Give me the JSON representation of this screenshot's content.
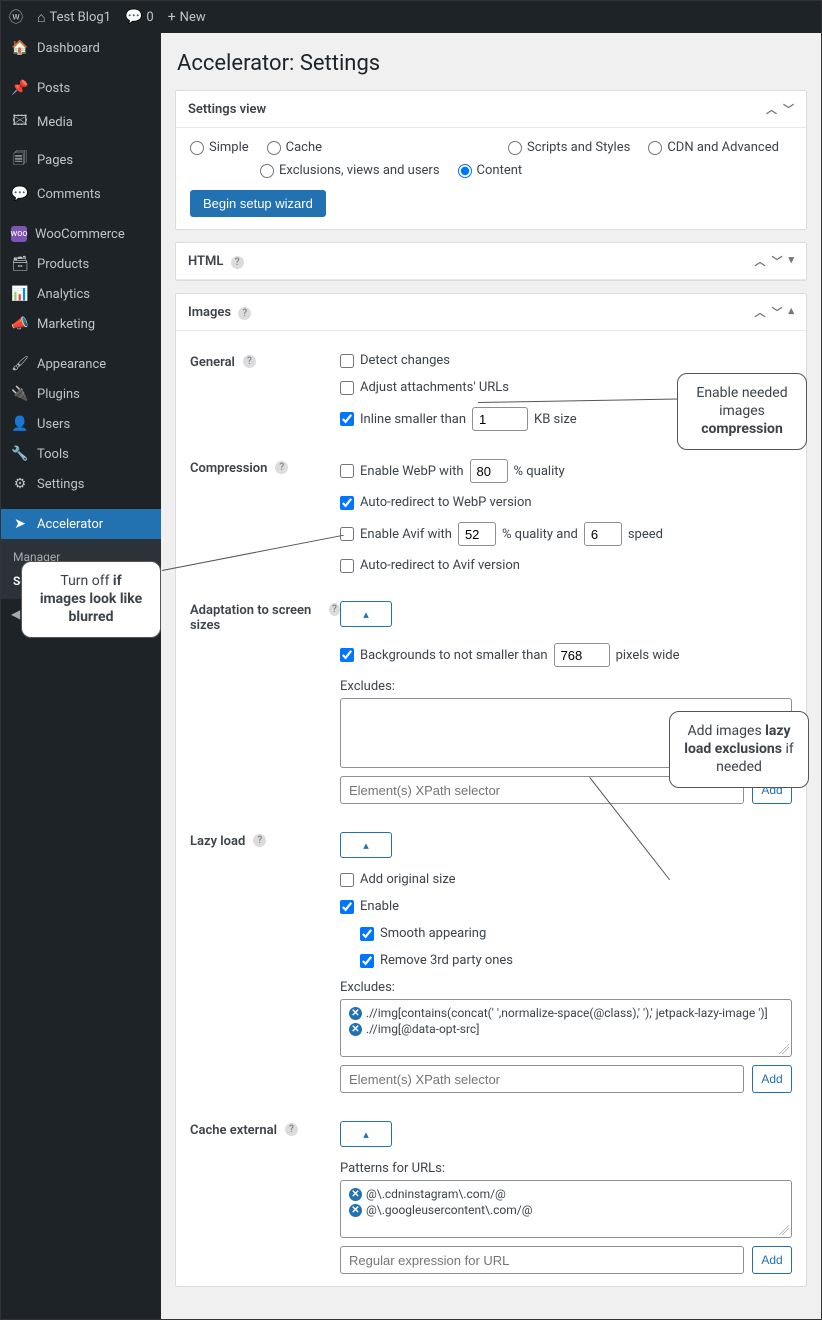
{
  "topbar": {
    "site_name": "Test Blog1",
    "comments_count": "0",
    "new_label": "New"
  },
  "sidebar": {
    "items": [
      {
        "icon": "⌂",
        "label": "Dashboard"
      },
      {
        "icon": "✎",
        "label": "Posts"
      },
      {
        "icon": "🖾",
        "label": "Media"
      },
      {
        "icon": "🗎",
        "label": "Pages"
      },
      {
        "icon": "💬",
        "label": "Comments"
      },
      {
        "icon": "woo",
        "label": "WooCommerce"
      },
      {
        "icon": "🗃",
        "label": "Products"
      },
      {
        "icon": "📊",
        "label": "Analytics"
      },
      {
        "icon": "📣",
        "label": "Marketing"
      },
      {
        "icon": "🖌",
        "label": "Appearance"
      },
      {
        "icon": "🔌",
        "label": "Plugins"
      },
      {
        "icon": "👤",
        "label": "Users"
      },
      {
        "icon": "🔧",
        "label": "Tools"
      },
      {
        "icon": "⚙",
        "label": "Settings"
      },
      {
        "icon": "➤",
        "label": "Accelerator"
      }
    ],
    "sub_manager": "Manager",
    "sub_settings": "Settings",
    "collapse": "Collapse menu"
  },
  "page": {
    "title": "Accelerator: Settings"
  },
  "settings_view": {
    "title": "Settings view",
    "radios": {
      "simple": "Simple",
      "cache": "Cache",
      "scripts": "Scripts and Styles",
      "cdn": "CDN and Advanced",
      "excl": "Exclusions, views and users",
      "content": "Content"
    },
    "wizard_btn": "Begin setup wizard"
  },
  "html_panel": {
    "title": "HTML"
  },
  "images_panel": {
    "title": "Images",
    "general": {
      "label": "General",
      "detect": "Detect changes",
      "adjust": "Adjust attachments' URLs",
      "inline_prefix": "Inline smaller than",
      "inline_value": "1",
      "inline_suffix": "KB size"
    },
    "compression": {
      "label": "Compression",
      "webp_prefix": "Enable WebP with",
      "webp_value": "80",
      "webp_suffix": "% quality",
      "auto_webp": "Auto-redirect to WebP version",
      "avif_prefix": "Enable Avif with",
      "avif_value": "52",
      "avif_mid": "% quality and",
      "avif_speed": "6",
      "avif_suffix": "speed",
      "auto_avif": "Auto-redirect to Avif version"
    },
    "adaptation": {
      "label": "Adaptation to screen sizes",
      "bg_prefix": "Backgrounds to not smaller than",
      "bg_value": "768",
      "bg_suffix": "pixels wide",
      "excludes_label": "Excludes:",
      "input_placeholder": "Element(s) XPath selector",
      "add_btn": "Add"
    },
    "lazy": {
      "label": "Lazy load",
      "add_orig": "Add original size",
      "enable": "Enable",
      "smooth": "Smooth appearing",
      "remove3rd": "Remove 3rd party ones",
      "excludes_label": "Excludes:",
      "excl1": ".//img[contains(concat(' ',normalize-space(@class),' '),' jetpack-lazy-image ')]",
      "excl2": ".//img[@data-opt-src]",
      "input_placeholder": "Element(s) XPath selector",
      "add_btn": "Add"
    },
    "cache_ext": {
      "label": "Cache external",
      "patterns_label": "Patterns for URLs:",
      "p1": "@\\.cdninstagram\\.com/@",
      "p2": "@\\.googleusercontent\\.com/@",
      "input_placeholder": "Regular expression for URL",
      "add_btn": "Add"
    }
  },
  "callouts": {
    "c1_line1": "Enable needed",
    "c1_line2": "images",
    "c1_line3": "compression",
    "c2_pre": "Turn off ",
    "c2_b1": "if images look like blurred",
    "c3_pre": "Add images ",
    "c3_b": "lazy load exclusions",
    "c3_post": " if needed"
  }
}
